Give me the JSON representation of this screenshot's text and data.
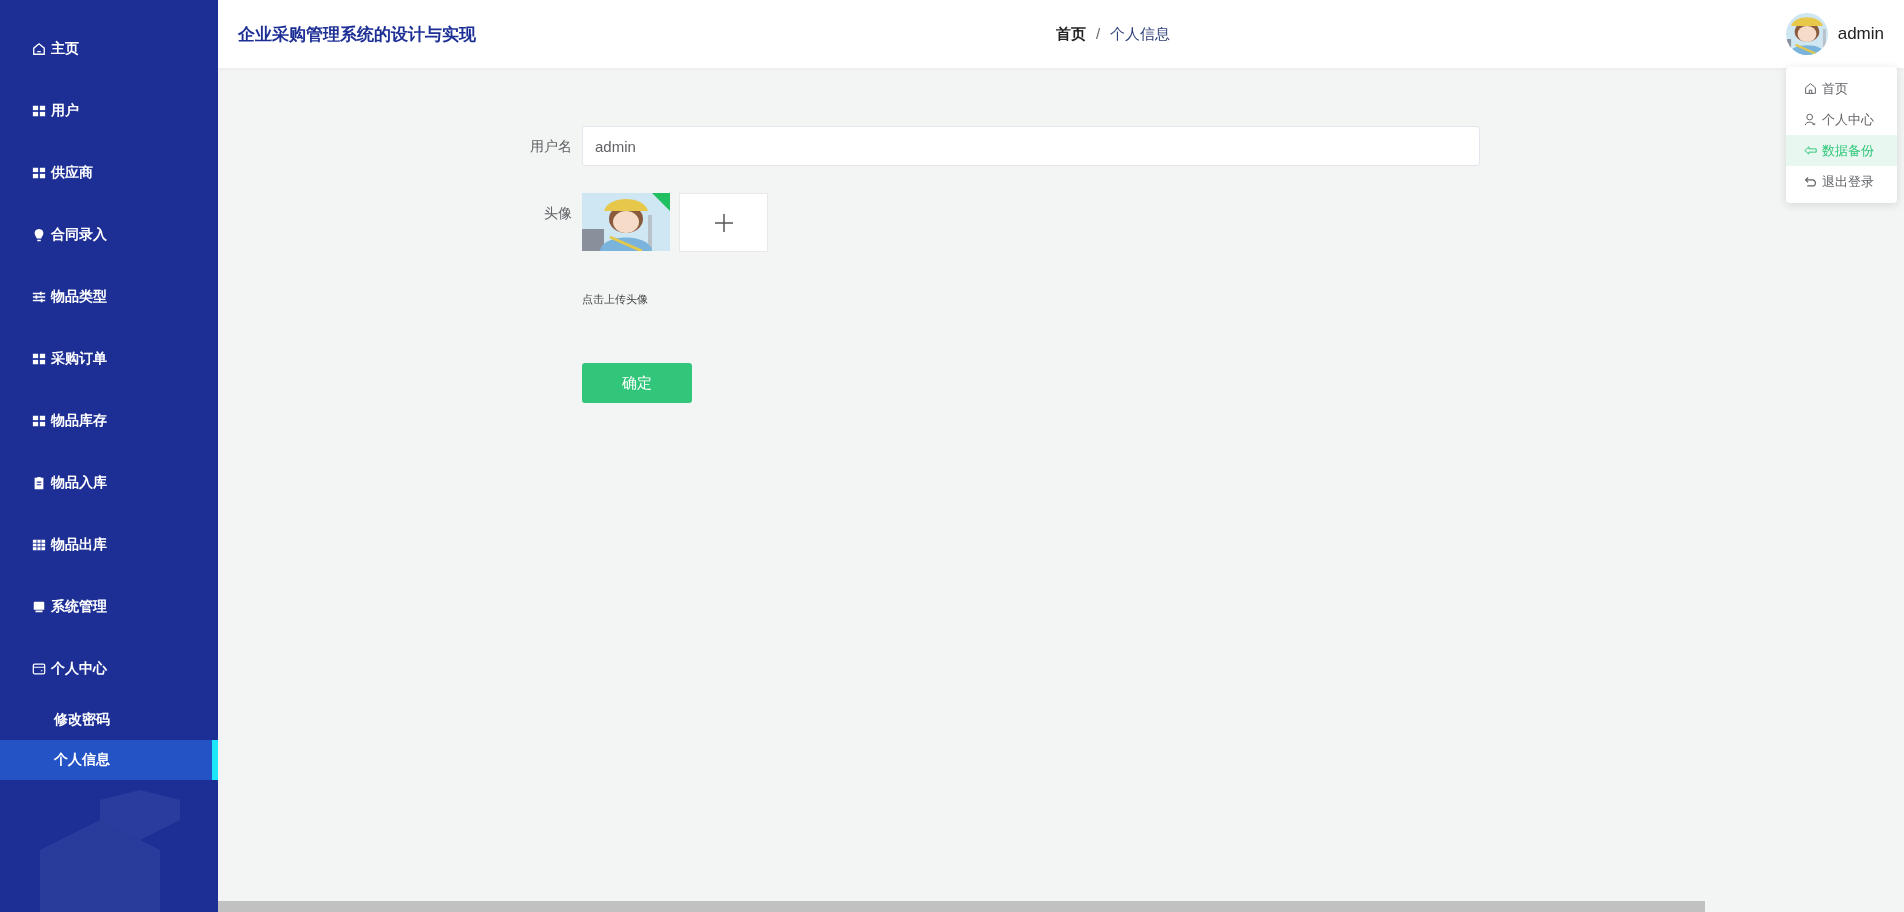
{
  "sidebar": {
    "items": [
      {
        "label": "主页",
        "kind": "home",
        "selected": false
      },
      {
        "label": "用户",
        "kind": "grid",
        "selected": false
      },
      {
        "label": "供应商",
        "kind": "grid",
        "selected": false
      },
      {
        "label": "合同录入",
        "kind": "bulb",
        "selected": false
      },
      {
        "label": "物品类型",
        "kind": "sliders",
        "selected": false
      },
      {
        "label": "采购订单",
        "kind": "grid",
        "selected": false
      },
      {
        "label": "物品库存",
        "kind": "grid",
        "selected": false
      },
      {
        "label": "物品入库",
        "kind": "clipboard",
        "selected": false
      },
      {
        "label": "物品出库",
        "kind": "table",
        "selected": false
      },
      {
        "label": "系统管理",
        "kind": "drawer",
        "selected": false
      },
      {
        "label": "个人中心",
        "kind": "wallet",
        "selected": false,
        "children": [
          {
            "label": "修改密码",
            "selected": false
          },
          {
            "label": "个人信息",
            "selected": true
          }
        ]
      }
    ]
  },
  "header": {
    "title": "企业采购管理系统的设计与实现",
    "breadcrumb": [
      {
        "label": "首页",
        "current": false
      },
      {
        "label": "个人信息",
        "current": true
      }
    ],
    "breadcrumb_separator": "/",
    "username": "admin"
  },
  "user_menu": {
    "items": [
      {
        "label": "首页",
        "kind": "home",
        "selected": false
      },
      {
        "label": "个人中心",
        "kind": "user",
        "selected": false
      },
      {
        "label": "数据备份",
        "kind": "back",
        "selected": true
      },
      {
        "label": "退出登录",
        "kind": "return",
        "selected": false
      }
    ]
  },
  "form": {
    "username_label": "用户名",
    "username_value": "admin",
    "avatar_label": "头像",
    "upload_hint": "点击上传头像",
    "submit": "确定"
  }
}
